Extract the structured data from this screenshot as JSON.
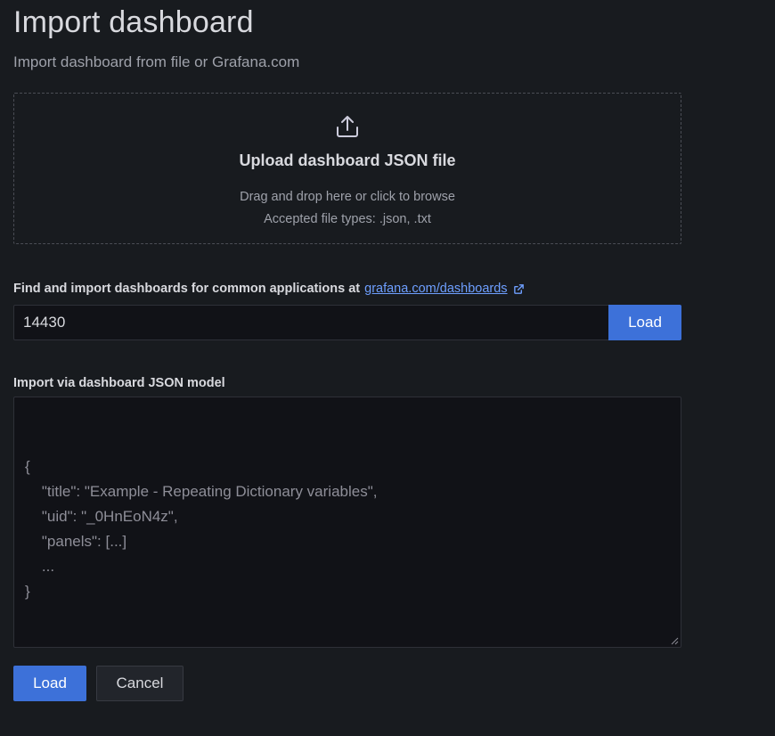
{
  "header": {
    "title": "Import dashboard",
    "subtitle": "Import dashboard from file or Grafana.com"
  },
  "upload": {
    "icon": "upload-icon",
    "title": "Upload dashboard JSON file",
    "hint": "Drag and drop here or click to browse",
    "accepted": "Accepted file types: .json, .txt"
  },
  "grafana_com": {
    "label": "Find and import dashboards for common applications at",
    "link_text": "grafana.com/dashboards",
    "link_icon": "external-link-icon",
    "input_value": "14430",
    "load_label": "Load"
  },
  "json_model": {
    "label": "Import via dashboard JSON model",
    "placeholder_lines": [
      "{",
      "    \"title\": \"Example - Repeating Dictionary variables\",",
      "    \"uid\": \"_0HnEoN4z\",",
      "    \"panels\": [...]",
      "    ...",
      "}"
    ]
  },
  "actions": {
    "load_label": "Load",
    "cancel_label": "Cancel"
  },
  "colors": {
    "background": "#181b1f",
    "primary": "#3d71d9",
    "link": "#6e9fff"
  }
}
